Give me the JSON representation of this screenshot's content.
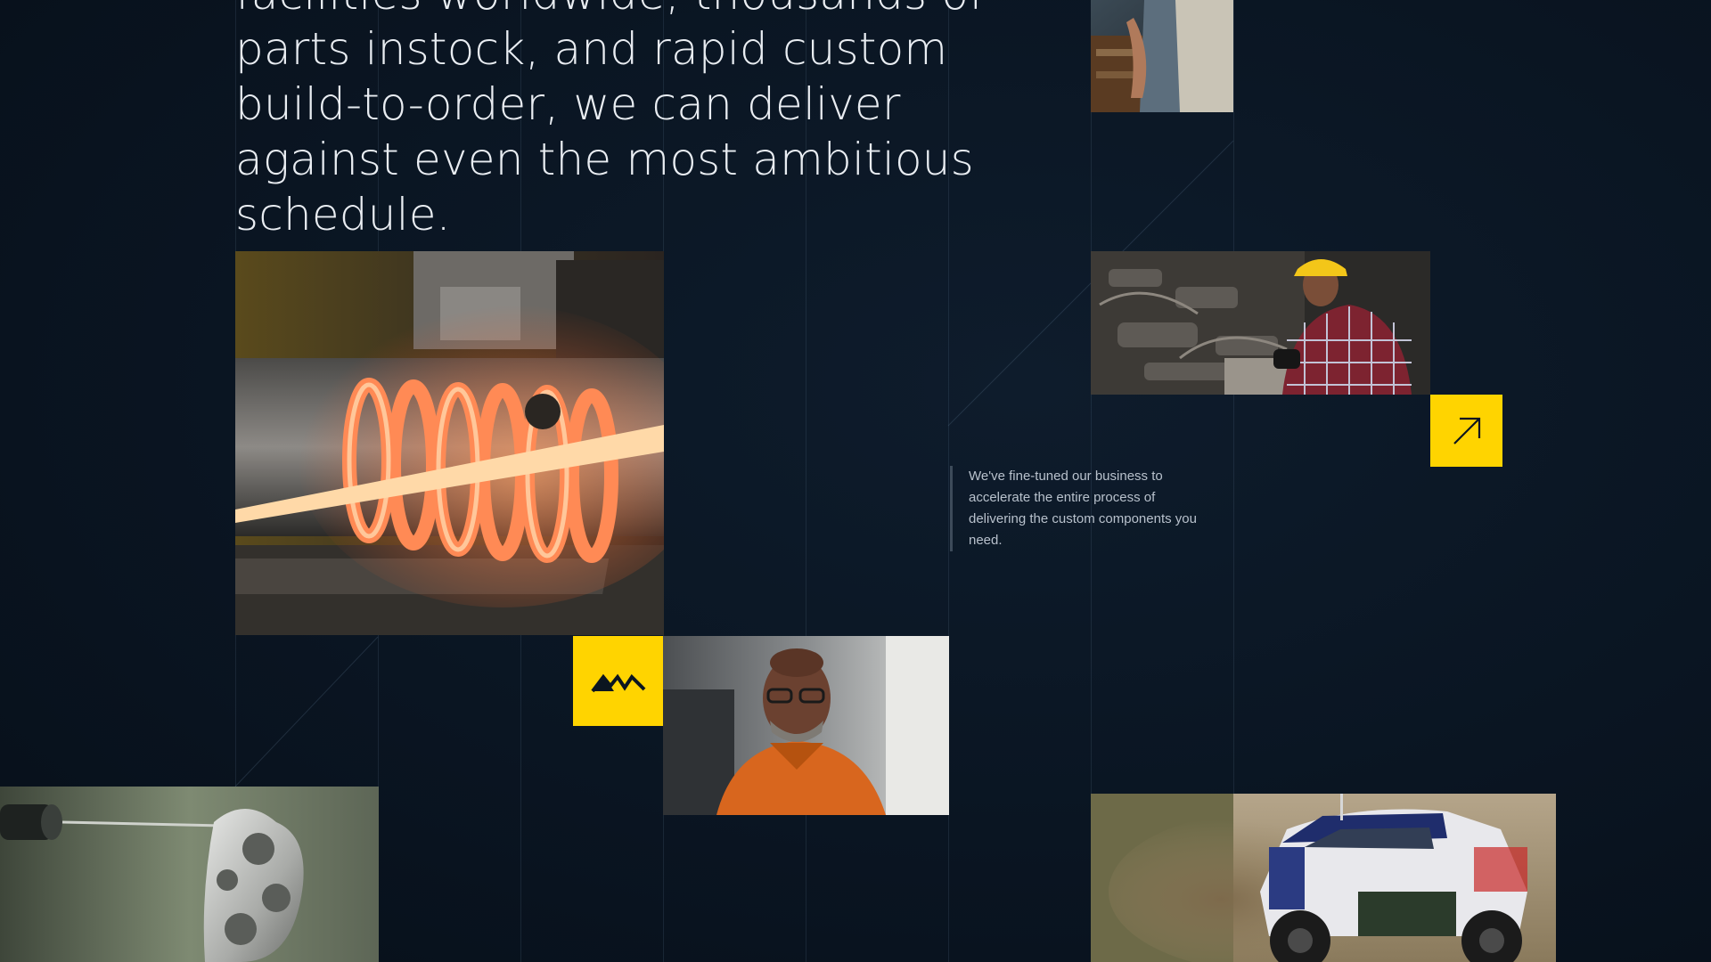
{
  "headline": {
    "text": "facilities worldwide, thousands of parts instock, and rapid custom build-to-order, we can deliver against even the most ambitious schedule."
  },
  "quote": {
    "text": "We've fine-tuned our business to accelerate the entire process of delivering the custom components you need."
  },
  "icons": {
    "arrow_tile": "arrow-up-right-icon",
    "logo_tile": "brand-logo-icon"
  },
  "colors": {
    "background": "#0a1522",
    "accent": "#ffd400",
    "text": "#e9edf2",
    "muted_text": "#b8c1cc"
  }
}
